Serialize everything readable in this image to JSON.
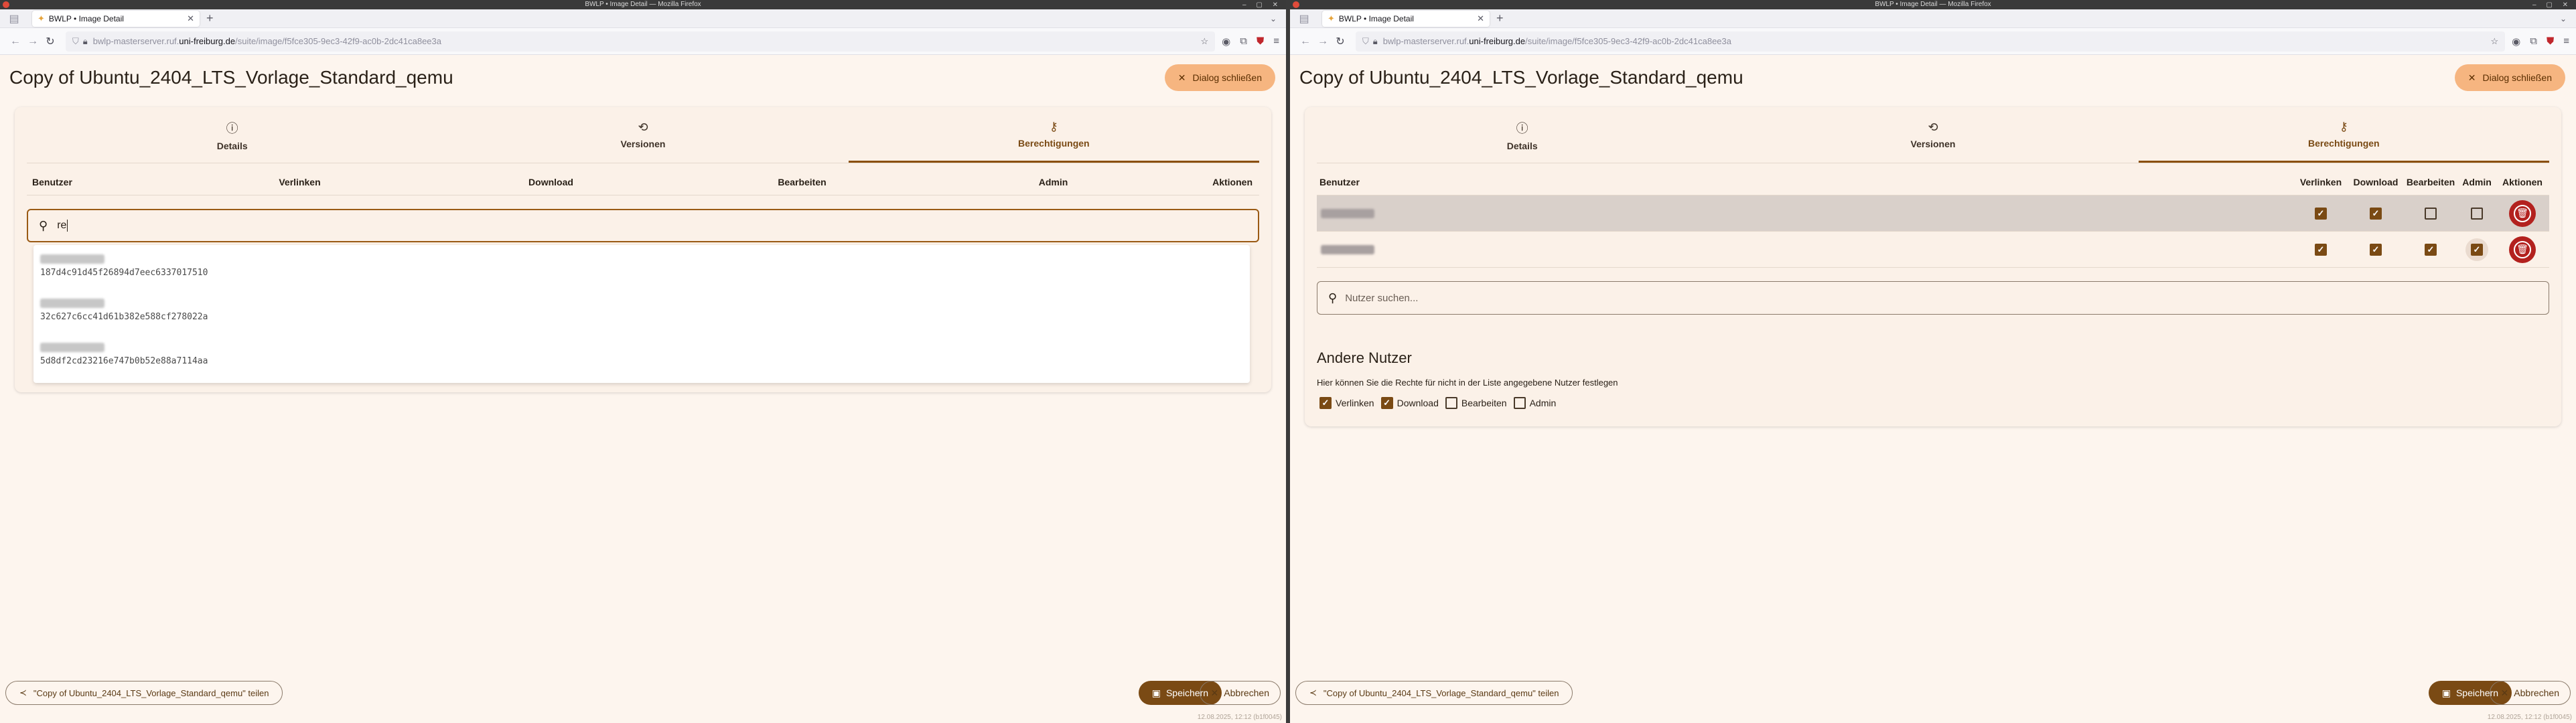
{
  "window": {
    "title": "BWLP • Image Detail — Mozilla Firefox"
  },
  "browser": {
    "tab_title": "BWLP • Image Detail",
    "url_prefix": "bwlp-masterserver.ruf.",
    "url_domain": "uni-freiburg.de",
    "url_path": "/suite/image/f5fce305-9ec3-42f9-ac0b-2dc41ca8ee3a"
  },
  "page": {
    "title": "Copy of Ubuntu_2404_LTS_Vorlage_Standard_qemu",
    "close_label": "Dialog schließen",
    "tabs": [
      "Details",
      "Versionen",
      "Berechtigungen"
    ],
    "share_label": "\"Copy of Ubuntu_2404_LTS_Vorlage_Standard_qemu\" teilen",
    "save_label": "Speichern",
    "cancel_label": "Abbrechen",
    "footer": "12.08.2025, 12:12 (b1f0045)"
  },
  "left": {
    "headers": [
      "Benutzer",
      "Verlinken",
      "Download",
      "Bearbeiten",
      "Admin",
      "Aktionen"
    ],
    "search_value": "re",
    "suggestions": [
      {
        "id": "187d4c91d45f26894d7eec6337017510"
      },
      {
        "id": "32c627c6cc41d61b382e588cf278022a"
      },
      {
        "id": "5d8df2cd23216e747b0b52e88a7114aa"
      }
    ]
  },
  "right": {
    "headers": [
      "Benutzer",
      "Verlinken",
      "Download",
      "Bearbeiten",
      "Admin",
      "Aktionen"
    ],
    "rows": [
      {
        "perms": [
          true,
          true,
          false,
          false
        ],
        "highlighted": true
      },
      {
        "perms": [
          true,
          true,
          true,
          true
        ],
        "highlighted": false
      }
    ],
    "search_placeholder": "Nutzer suchen...",
    "other_title": "Andere Nutzer",
    "other_desc": "Hier können Sie die Rechte für nicht in der Liste angegebene Nutzer festlegen",
    "other_perms": [
      {
        "label": "Verlinken",
        "checked": true
      },
      {
        "label": "Download",
        "checked": true
      },
      {
        "label": "Bearbeiten",
        "checked": false
      },
      {
        "label": "Admin",
        "checked": false
      }
    ]
  },
  "icons": [
    "info-icon",
    "history-icon",
    "key-icon",
    "search-icon",
    "close-icon",
    "share-icon",
    "save-icon",
    "trash-icon"
  ],
  "colors": {
    "accent": "#7a4a14",
    "close_button": "#f6b580",
    "delete": "#b3211e",
    "background": "#fdf5ee"
  }
}
